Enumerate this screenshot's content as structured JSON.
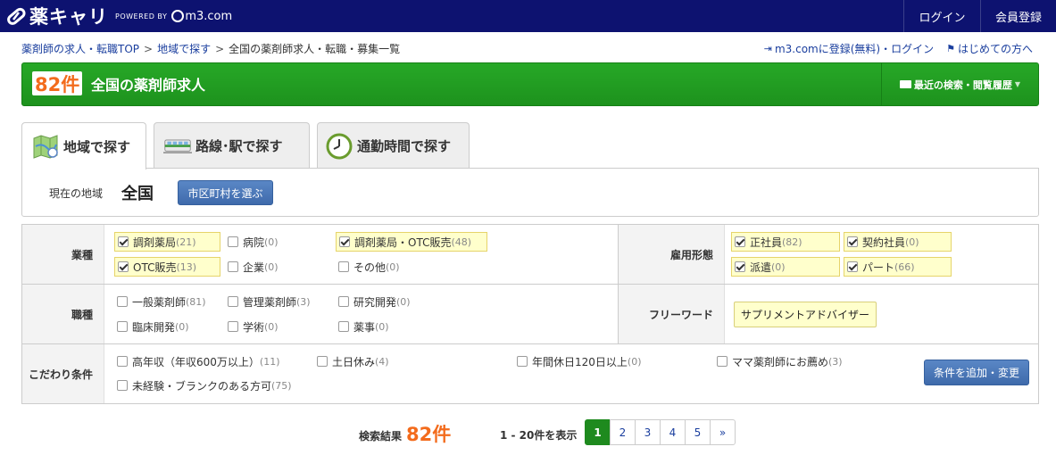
{
  "header": {
    "logo_text": "薬キャリ",
    "powered_by": "POWERED BY",
    "m3_text": "m3.com",
    "nav": {
      "login": "ログイン",
      "register": "会員登録"
    }
  },
  "breadcrumb": {
    "items": [
      "薬剤師の求人・転職TOP",
      "地域で探す",
      "全国の薬剤師求人・転職・募集一覧"
    ],
    "separator": ">"
  },
  "top_links": {
    "m3_login": "m3.comに登録(無料)・ログイン",
    "first_time": "はじめての方へ"
  },
  "title_bar": {
    "count": "82件",
    "title": "全国の薬剤師求人",
    "history": "最近の検索・閲覧履歴"
  },
  "tabs": [
    {
      "label": "地域で探す",
      "active": true
    },
    {
      "label": "路線･駅で探す",
      "active": false
    },
    {
      "label": "通勤時間で探す",
      "active": false
    }
  ],
  "area": {
    "label": "現在の地域",
    "value": "全国",
    "button": "市区町村を選ぶ"
  },
  "filters": {
    "industry": {
      "label": "業種",
      "options": [
        {
          "name": "調剤薬局",
          "count": "(21)",
          "checked": true
        },
        {
          "name": "病院",
          "count": "(0)",
          "checked": false
        },
        {
          "name": "調剤薬局・OTC販売",
          "count": "(48)",
          "checked": true
        },
        {
          "name": "OTC販売",
          "count": "(13)",
          "checked": true
        },
        {
          "name": "企業",
          "count": "(0)",
          "checked": false
        },
        {
          "name": "その他",
          "count": "(0)",
          "checked": false
        }
      ]
    },
    "employment": {
      "label": "雇用形態",
      "options": [
        {
          "name": "正社員",
          "count": "(82)",
          "checked": true
        },
        {
          "name": "契約社員",
          "count": "(0)",
          "checked": true
        },
        {
          "name": "派遣",
          "count": "(0)",
          "checked": true
        },
        {
          "name": "パート",
          "count": "(66)",
          "checked": true
        }
      ]
    },
    "job_type": {
      "label": "職種",
      "options": [
        {
          "name": "一般薬剤師",
          "count": "(81)",
          "checked": false
        },
        {
          "name": "管理薬剤師",
          "count": "(3)",
          "checked": false
        },
        {
          "name": "研究開発",
          "count": "(0)",
          "checked": false
        },
        {
          "name": "臨床開発",
          "count": "(0)",
          "checked": false
        },
        {
          "name": "学術",
          "count": "(0)",
          "checked": false
        },
        {
          "name": "薬事",
          "count": "(0)",
          "checked": false
        }
      ]
    },
    "freeword": {
      "label": "フリーワード",
      "value": "サプリメントアドバイザー"
    },
    "preferences": {
      "label": "こだわり条件",
      "options": [
        {
          "name": "高年収（年収600万以上）",
          "count": "(11)",
          "checked": false
        },
        {
          "name": "土日休み",
          "count": "(4)",
          "checked": false
        },
        {
          "name": "年間休日120日以上",
          "count": "(0)",
          "checked": false
        },
        {
          "name": "ママ薬剤師にお薦め",
          "count": "(3)",
          "checked": false
        },
        {
          "name": "未経験・ブランクのある方可",
          "count": "(75)",
          "checked": false
        }
      ],
      "button": "条件を追加・変更"
    }
  },
  "results": {
    "label": "検索結果",
    "count": "82件",
    "range": "1 - 20件を表示",
    "pages": [
      "1",
      "2",
      "3",
      "4",
      "5",
      "»"
    ],
    "current_page": "1"
  },
  "colors": {
    "header_bg": "#0d1270",
    "title_green": "#1d921d",
    "accent_orange": "#f36b1c",
    "link_blue": "#1a3e9e",
    "selected_bg": "#ffffcc"
  }
}
